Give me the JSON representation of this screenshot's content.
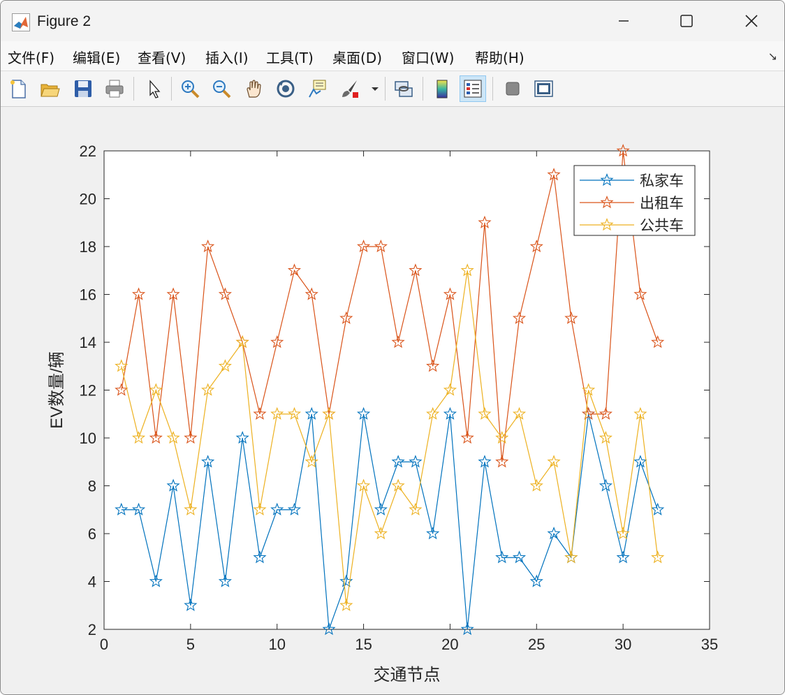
{
  "window": {
    "title": "Figure 2",
    "icon": "matlab-icon",
    "controls": [
      "minimize-icon",
      "maximize-icon",
      "close-icon"
    ]
  },
  "menu": [
    {
      "label": "文件(F)"
    },
    {
      "label": "编辑(E)"
    },
    {
      "label": "查看(V)"
    },
    {
      "label": "插入(I)"
    },
    {
      "label": "工具(T)"
    },
    {
      "label": "桌面(D)"
    },
    {
      "label": "窗口(W)"
    },
    {
      "label": "帮助(H)"
    }
  ],
  "toolbar": [
    "new-figure-icon",
    "open-file-icon",
    "save-icon",
    "print-icon",
    "pointer-icon",
    "zoom-in-icon",
    "zoom-out-icon",
    "pan-icon",
    "rotate-icon",
    "data-tips-icon",
    "brush-icon",
    "brush-dropdown-icon",
    "link-plot-icon",
    "colorbar-icon",
    "legend-icon",
    "hide-plot-tools-icon",
    "show-plot-tools-icon"
  ],
  "chart_data": {
    "type": "line",
    "marker": "pentagram",
    "xlabel": "交通节点",
    "ylabel": "EV数量/辆",
    "xlim": [
      0,
      35
    ],
    "ylim": [
      2,
      22
    ],
    "xticks": [
      0,
      5,
      10,
      15,
      20,
      25,
      30,
      35
    ],
    "yticks": [
      2,
      4,
      6,
      8,
      10,
      12,
      14,
      16,
      18,
      20,
      22
    ],
    "grid": false,
    "legend_position": "top-right",
    "x": [
      1,
      2,
      3,
      4,
      5,
      6,
      7,
      8,
      9,
      10,
      11,
      12,
      13,
      14,
      15,
      16,
      17,
      18,
      19,
      20,
      21,
      22,
      23,
      24,
      25,
      26,
      27,
      28,
      29,
      30,
      31,
      32
    ],
    "series": [
      {
        "name": "私家车",
        "color": "#0072BD",
        "values": [
          7,
          7,
          4,
          8,
          3,
          9,
          4,
          10,
          5,
          7,
          7,
          11,
          2,
          4,
          11,
          7,
          9,
          9,
          6,
          11,
          2,
          9,
          5,
          5,
          4,
          6,
          5,
          11,
          8,
          5,
          9,
          7
        ]
      },
      {
        "name": "出租车",
        "color": "#D95319",
        "values": [
          12,
          16,
          10,
          16,
          10,
          18,
          16,
          14,
          11,
          14,
          17,
          16,
          11,
          15,
          18,
          18,
          14,
          17,
          13,
          16,
          10,
          19,
          9,
          15,
          18,
          21,
          15,
          11,
          11,
          22,
          16,
          14
        ]
      },
      {
        "name": "公共车",
        "color": "#EDB120",
        "values": [
          13,
          10,
          12,
          10,
          7,
          12,
          13,
          14,
          7,
          11,
          11,
          9,
          11,
          3,
          8,
          6,
          8,
          7,
          11,
          12,
          17,
          11,
          10,
          11,
          8,
          9,
          5,
          12,
          10,
          6,
          11,
          5
        ]
      }
    ]
  }
}
